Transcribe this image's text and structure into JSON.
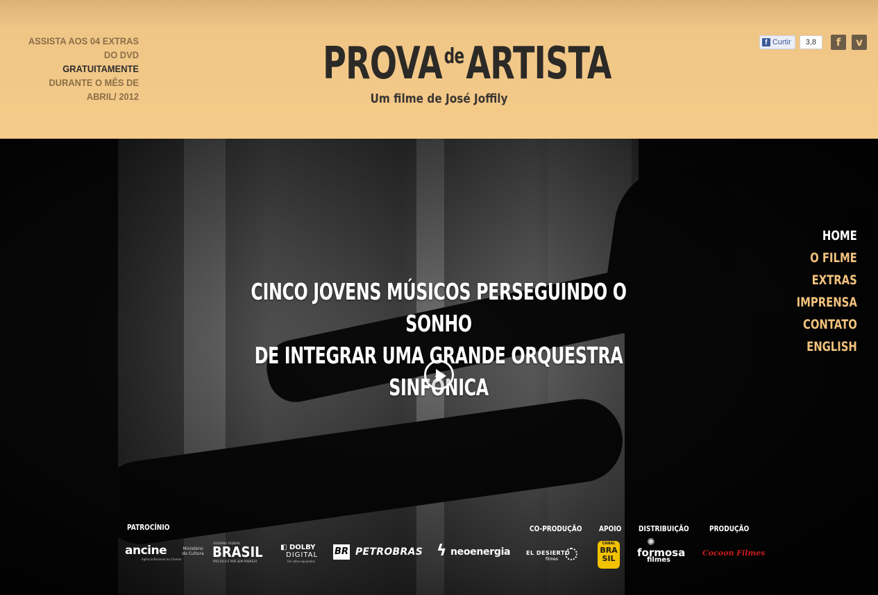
{
  "header": {
    "promo": {
      "line1": "ASSISTA AOS 04 EXTRAS",
      "line2": "DO DVD",
      "line3": "GRATUITAMENTE",
      "line4": "DURANTE O MÊS DE",
      "line5": "ABRIL/ 2012"
    },
    "logo": {
      "word1": "PROVA",
      "word2": "de",
      "word3": "ARTISTA"
    },
    "tagline": "Um filme de José Joffily",
    "social": {
      "like_label": "Curtir",
      "like_glyph": "f",
      "like_count": "3,8",
      "facebook_glyph": "f",
      "vimeo_glyph": "v"
    }
  },
  "hero": {
    "headline_line1": "CINCO JOVENS MÚSICOS PERSEGUINDO O SONHO",
    "headline_line2": "DE INTEGRAR UMA GRANDE ORQUESTRA SINFÔNICA"
  },
  "nav": {
    "items": [
      {
        "label": "HOME",
        "active": true
      },
      {
        "label": "O FILME",
        "active": false
      },
      {
        "label": "EXTRAS",
        "active": false
      },
      {
        "label": "IMPRENSA",
        "active": false
      },
      {
        "label": "CONTATO",
        "active": false
      },
      {
        "label": "ENGLISH",
        "active": false
      }
    ]
  },
  "sponsors": {
    "patrocinio_label": "PATROCÍNIO",
    "coproducao_label": "CO-PRODUÇÃO",
    "apoio_label": "APOIO",
    "distribuicao_label": "DISTRIBUIÇÃO",
    "producao_label": "PRODUÇÃO",
    "ancine": "ancine",
    "ancine_sub": "Agência Nacional do Cinema",
    "ministerio": "Ministério da Cultura",
    "brasil_top": "GOVERNO FEDERAL",
    "brasil": "BRASIL",
    "brasil_sub": "PAÍS RICO É PAÍS SEM POBREZA",
    "dolby": "DOLBY",
    "dolby_digital": "DIGITAL",
    "dolby_sub": "Em salas equipadas",
    "br": "BR",
    "petrobras": "PETROBRAS",
    "neo_icon": "ϟ",
    "neoenergia": "neoenergia",
    "desierto": "EL DESIERTO",
    "desierto_sub": "filmes",
    "canal": "CANAL",
    "canal_bra": "BRA",
    "canal_sil": "SIL",
    "formosa": "formosa",
    "formosa_sub": "filmes",
    "cocoon": "Cocoon Filmes"
  },
  "colors": {
    "header_bg": "#f5cb8a",
    "nav_link": "#f2c27d",
    "nav_active": "#ffffff",
    "canal_yellow": "#f2c200",
    "cocoon_red": "#c81d1d"
  }
}
